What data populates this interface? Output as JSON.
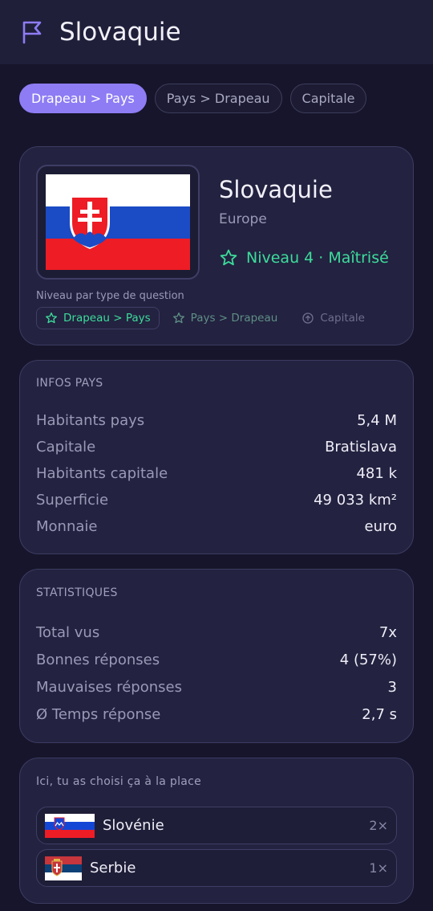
{
  "header": {
    "title": "Slovaquie",
    "icon": "flag-outline-icon"
  },
  "chips": [
    {
      "label": "Drapeau > Pays",
      "active": true
    },
    {
      "label": "Pays > Drapeau",
      "active": false
    },
    {
      "label": "Capitale",
      "active": false
    }
  ],
  "country": {
    "name": "Slovaquie",
    "continent": "Europe",
    "level": "Niveau 4 · Maîtrisé",
    "level_caption": "Niveau par type de question",
    "question_types": [
      "Drapeau > Pays",
      "Pays > Drapeau",
      "Capitale"
    ],
    "colors": {
      "mastered": "#3ddc9b",
      "accent": "#8d7cf4"
    }
  },
  "infos": {
    "title": "INFOS PAYS",
    "rows": [
      {
        "label": "Habitants pays",
        "value": "5,4 M"
      },
      {
        "label": "Capitale",
        "value": "Bratislava"
      },
      {
        "label": "Habitants capitale",
        "value": "481 k"
      },
      {
        "label": "Superficie",
        "value": "49 033 km²"
      },
      {
        "label": "Monnaie",
        "value": "euro"
      }
    ]
  },
  "stats": {
    "title": "STATISTIQUES",
    "rows": [
      {
        "label": "Total vus",
        "value": "7x"
      },
      {
        "label": "Bonnes réponses",
        "value": "4 (57%)"
      },
      {
        "label": "Mauvaises réponses",
        "value": "3"
      },
      {
        "label": "Ø Temps réponse",
        "value": "2,7 s"
      }
    ]
  },
  "wrong": {
    "title": "Ici, tu as choisi ça à la place",
    "items": [
      {
        "name": "Slovénie",
        "count": "2×"
      },
      {
        "name": "Serbie",
        "count": "1×"
      }
    ]
  }
}
